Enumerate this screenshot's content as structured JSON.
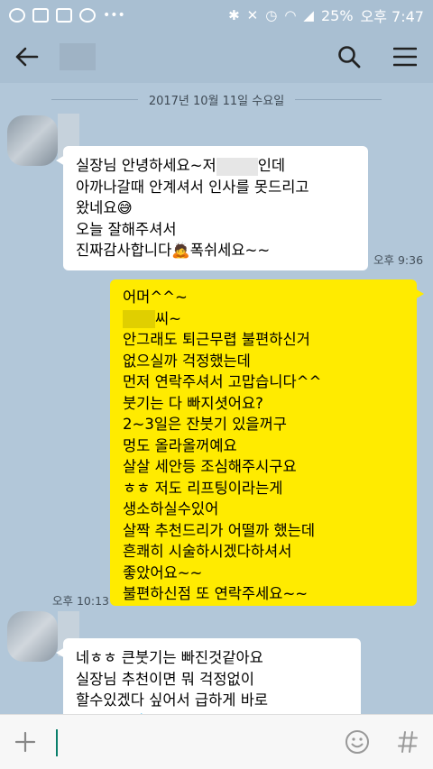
{
  "status_bar": {
    "battery": "25%",
    "time": "오후 7:47"
  },
  "date_divider": "2017년 10월 11일 수요일",
  "messages": [
    {
      "lines_before": "실장님 안녕하세요~저",
      "lines_after": "인데\n아까나갈때 안계셔서 인사를 못드리고\n왔네요😅\n오늘 잘해주셔서\n진짜감사합니다🙇폭쉬세요~~",
      "time": "오후 9:36"
    },
    {
      "line1": "어머^^~",
      "line2_suffix": "씨~",
      "body": "안그래도 퇴근무렵 불편하신거\n없으실까 걱정했는데\n먼저 연락주셔서 고맙습니다^^\n붓기는 다 빠지셧어요?\n2~3일은 잔붓기 있을꺼구\n멍도 올라올꺼예요\n살살 세안등 조심해주시구요\nㅎㅎ 저도 리프팅이라는게\n생소하실수있어\n살짝 추천드리가 어떨까 했는데\n흔쾌히 시술하시겠다하셔서\n좋았어요~~\n불편하신점 또 연락주세요~~",
      "time": "오후 10:13"
    },
    {
      "text": "네ㅎㅎ 큰붓기는 빠진것같아요\n실장님 추천이면 뭐 걱정없이\n할수있겠다 싶어서 급하게 바로\n했네요😅💧 그로 벌떄마다"
    }
  ]
}
